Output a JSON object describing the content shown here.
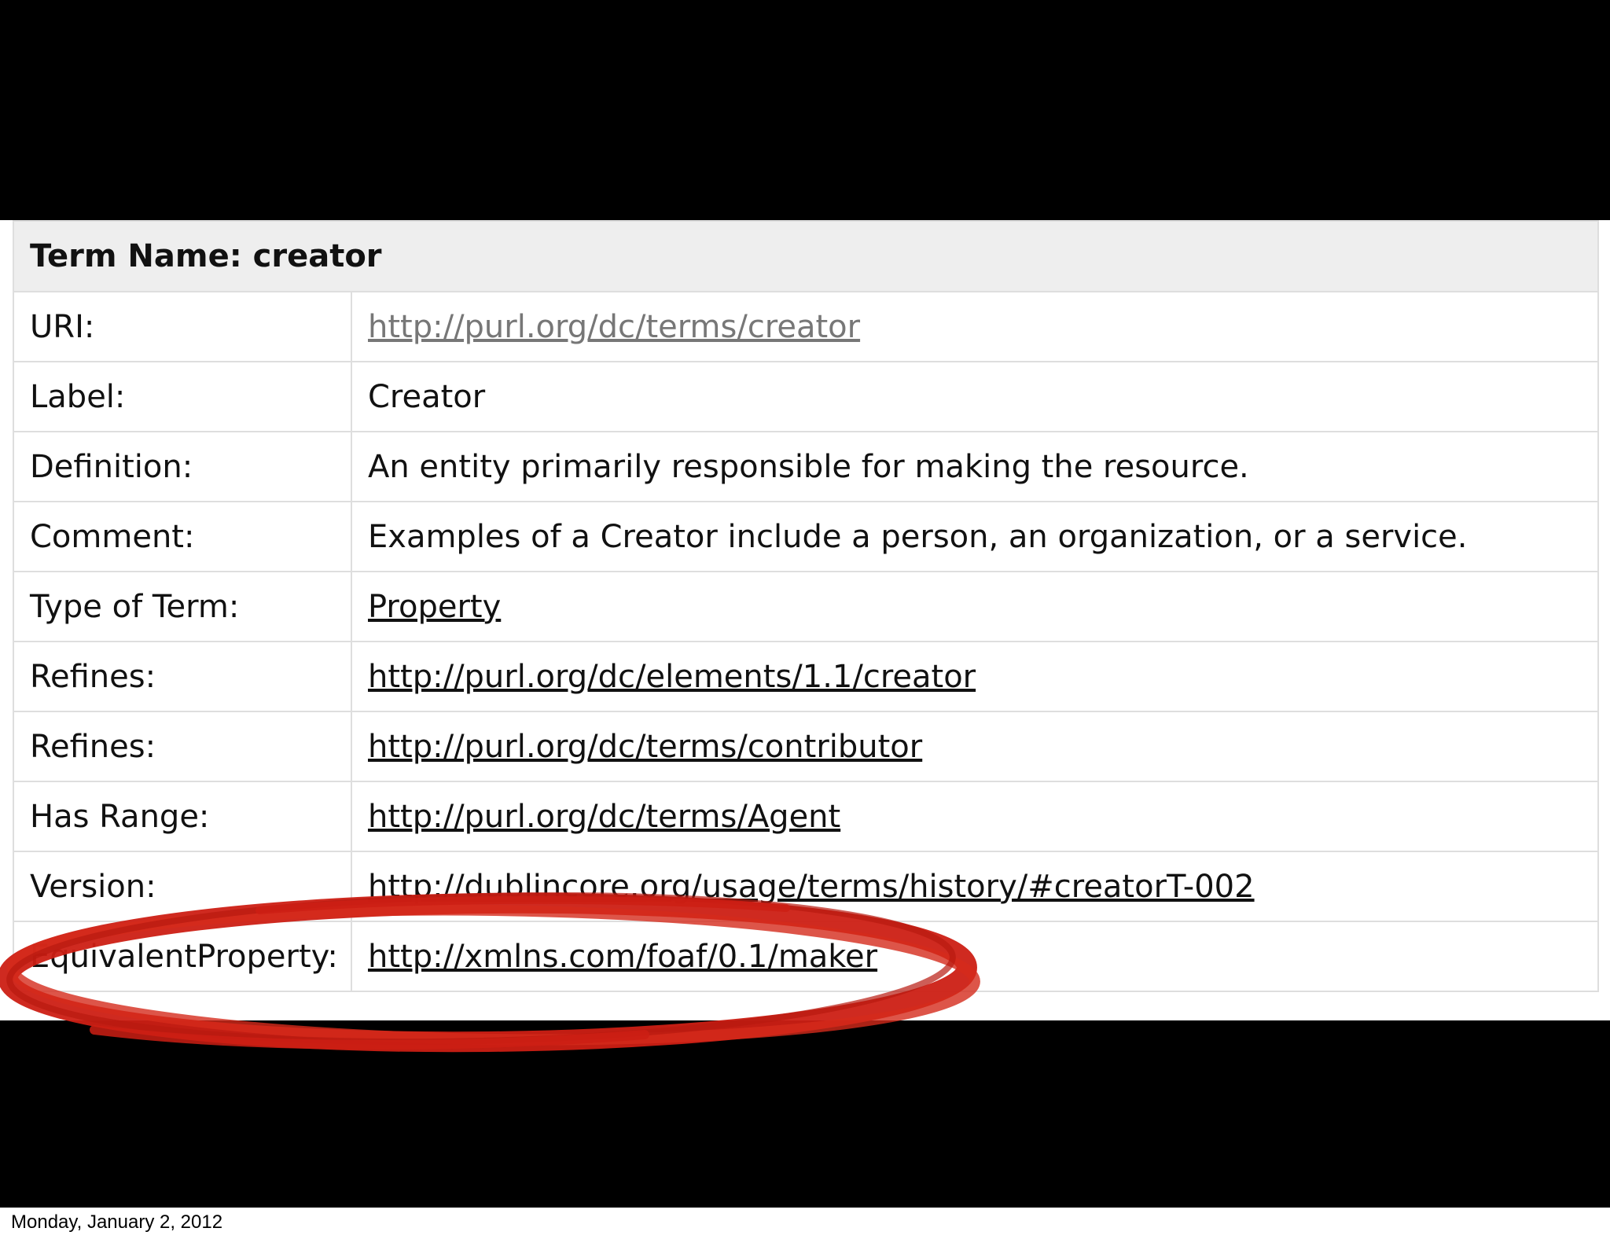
{
  "table": {
    "header": "Term Name: creator",
    "rows": [
      {
        "label": "URI:",
        "value": "http://purl.org/dc/terms/creator",
        "is_link": true,
        "visited": true
      },
      {
        "label": "Label:",
        "value": "Creator",
        "is_link": false
      },
      {
        "label": "Definition:",
        "value": "An entity primarily responsible for making the resource.",
        "is_link": false
      },
      {
        "label": "Comment:",
        "value": "Examples of a Creator include a person, an organization, or a service.",
        "is_link": false
      },
      {
        "label": "Type of Term:",
        "value": "Property",
        "is_link": true
      },
      {
        "label": "Refines:",
        "value": "http://purl.org/dc/elements/1.1/creator",
        "is_link": true
      },
      {
        "label": "Refines:",
        "value": "http://purl.org/dc/terms/contributor",
        "is_link": true
      },
      {
        "label": "Has Range:",
        "value": "http://purl.org/dc/terms/Agent",
        "is_link": true
      },
      {
        "label": "Version:",
        "value": "http://dublincore.org/usage/terms/history/#creatorT-002",
        "is_link": true
      },
      {
        "label": "EquivalentProperty:",
        "value": "http://xmlns.com/foaf/0.1/maker",
        "is_link": true
      }
    ]
  },
  "annotation": {
    "shape": "hand-drawn-ellipse",
    "color": "#cc1f14",
    "target_row": "EquivalentProperty:"
  },
  "footer": {
    "date": "Monday, January 2, 2012"
  },
  "colors": {
    "background": "#000000",
    "header_bg": "#eeeeee",
    "border": "#dedede",
    "visited_link": "#777777"
  }
}
